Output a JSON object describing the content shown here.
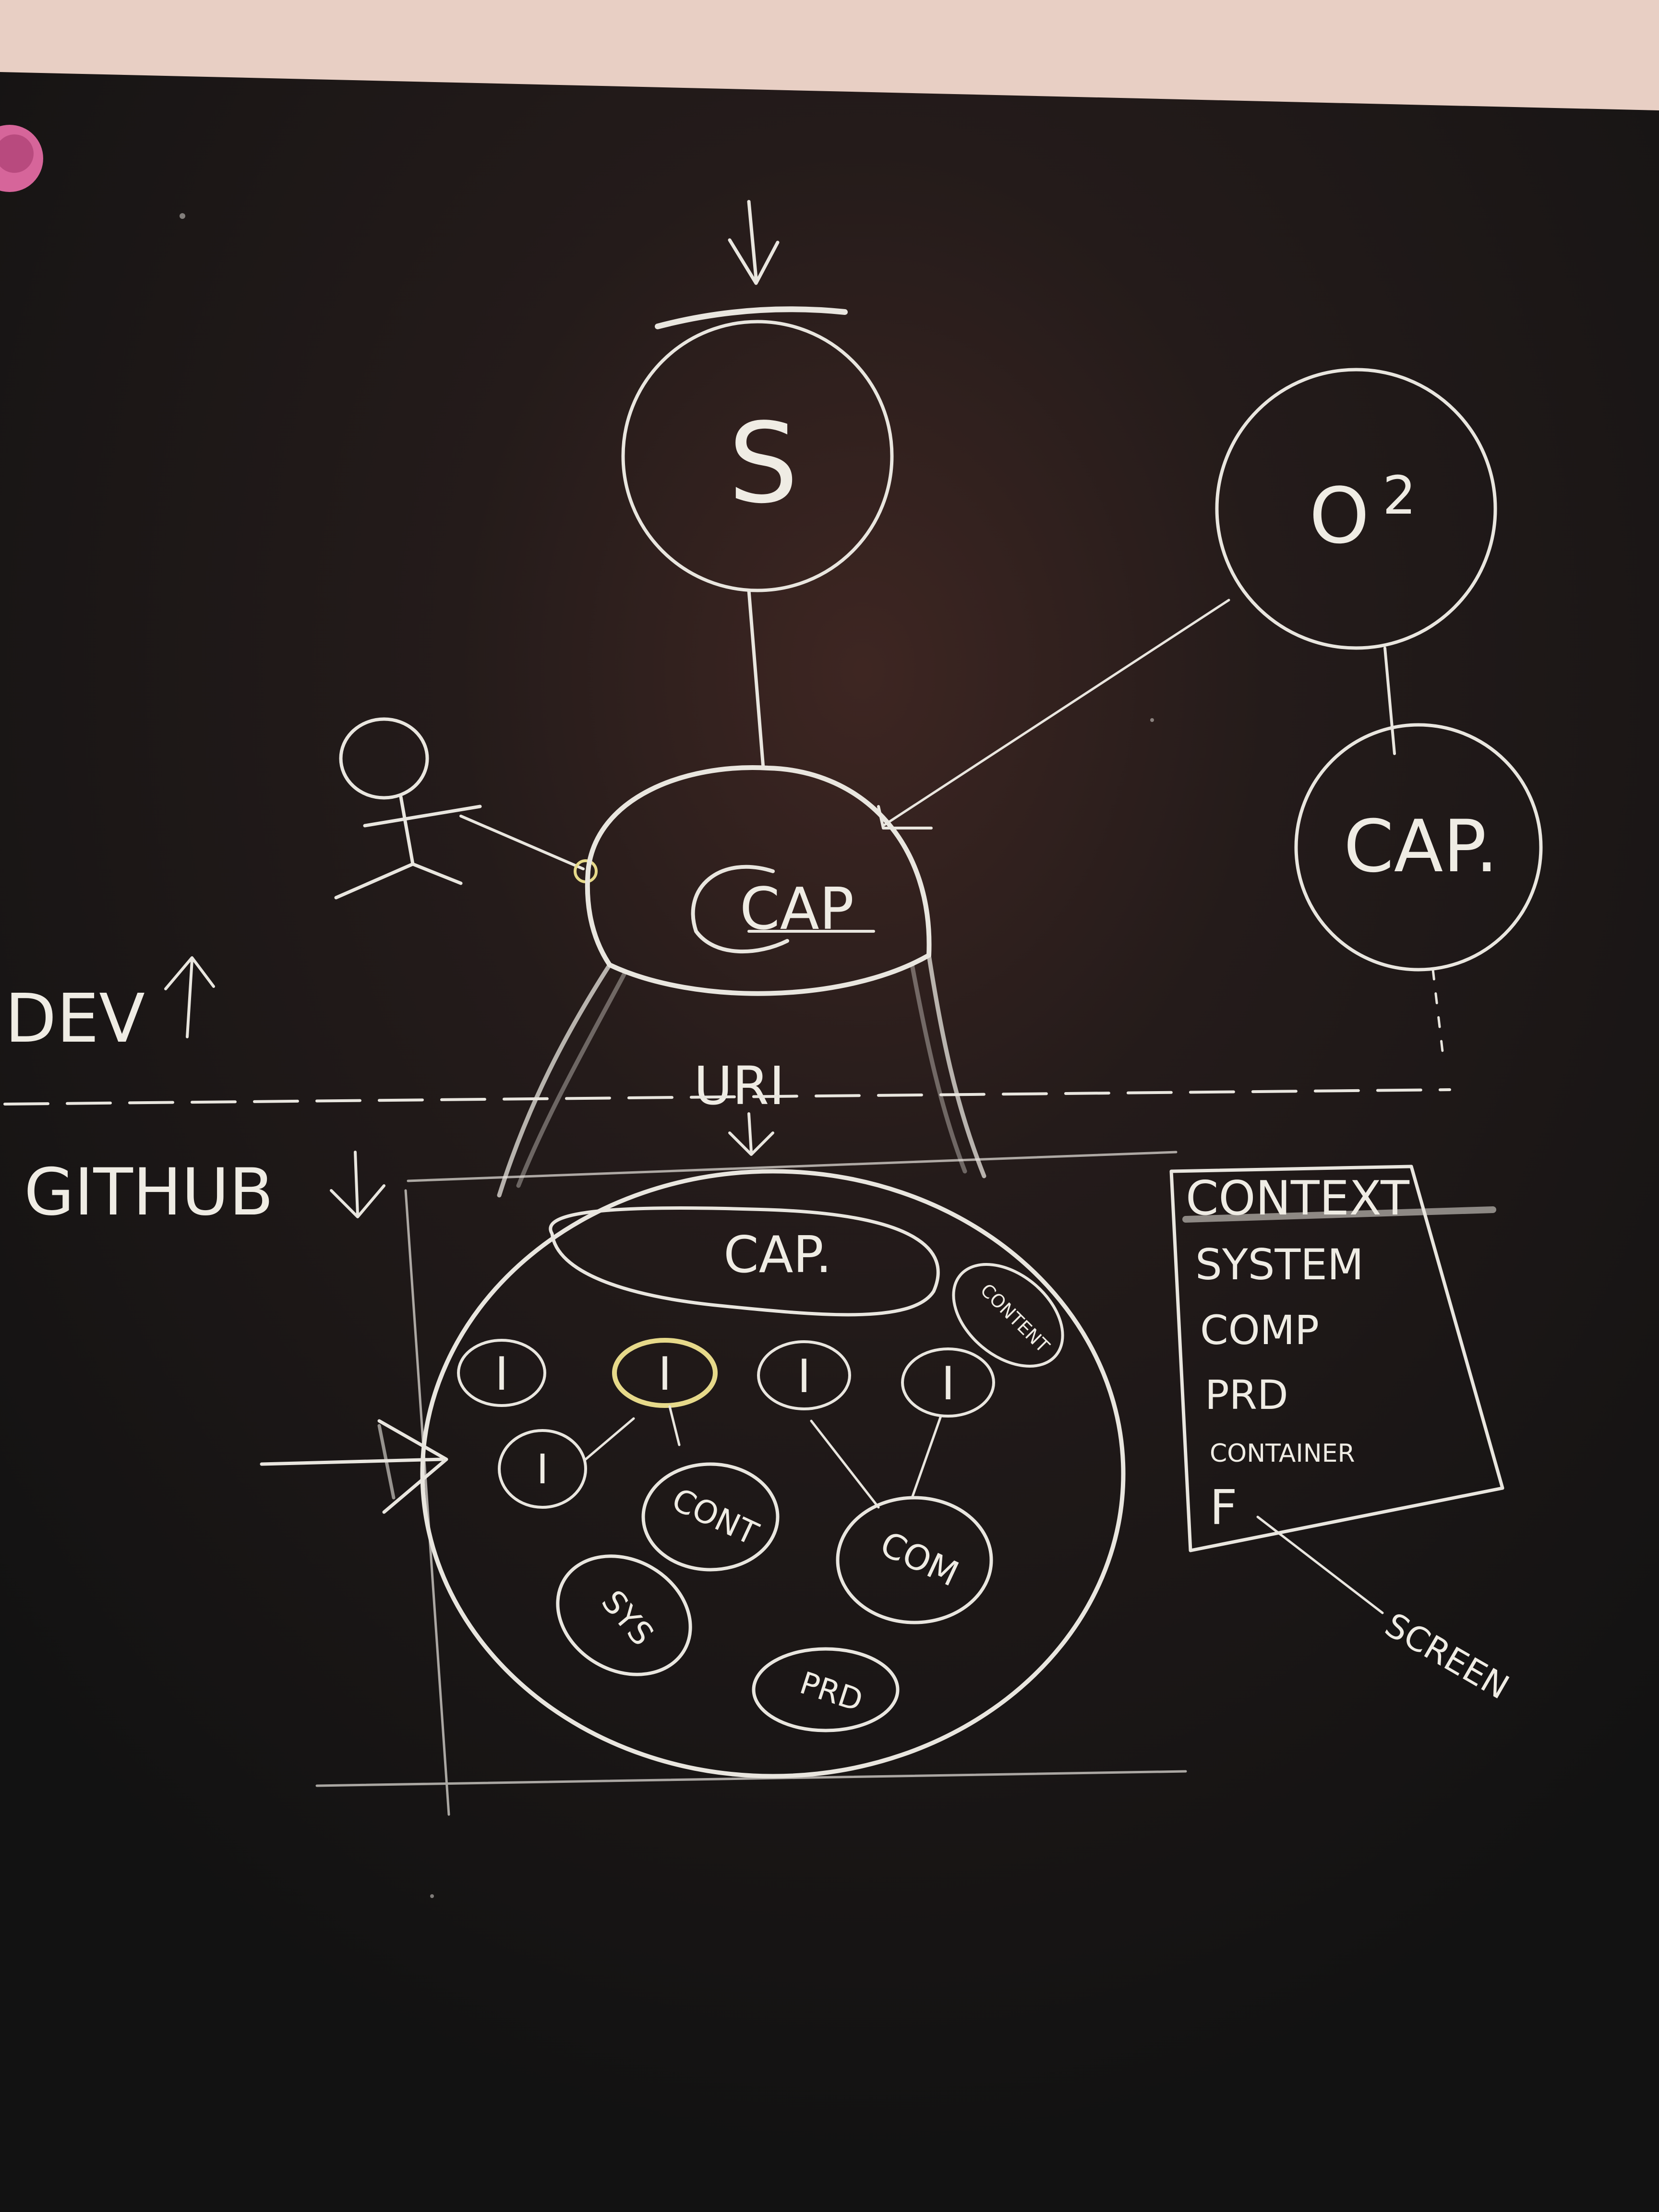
{
  "diagram": {
    "nodes": {
      "s": "S",
      "o2": "O",
      "o2_sup": "2",
      "cap_right": "CAP.",
      "cap_center": "CAP",
      "uri": "URI",
      "cap_inner": "CAP.",
      "content_small": "CONTENT",
      "i_nodes": [
        "I",
        "I",
        "I",
        "I",
        "I"
      ],
      "cont": "CONT",
      "com": "COM",
      "sys": "SYS",
      "prd": "PRD"
    },
    "side_labels": {
      "dev": "DEV",
      "github": "GITHUB"
    },
    "list_box": {
      "items": [
        "CONTEXT",
        "SYSTEM",
        "COMP",
        "PRD",
        "CONTAINER",
        "F"
      ]
    },
    "annotation": "SCREEN"
  },
  "colors": {
    "board": "#161616",
    "wall": "#e8cfc4",
    "chalk": "#e9e6df",
    "chalk_yellow": "#e6d98a",
    "sticker": "#d6659a"
  }
}
